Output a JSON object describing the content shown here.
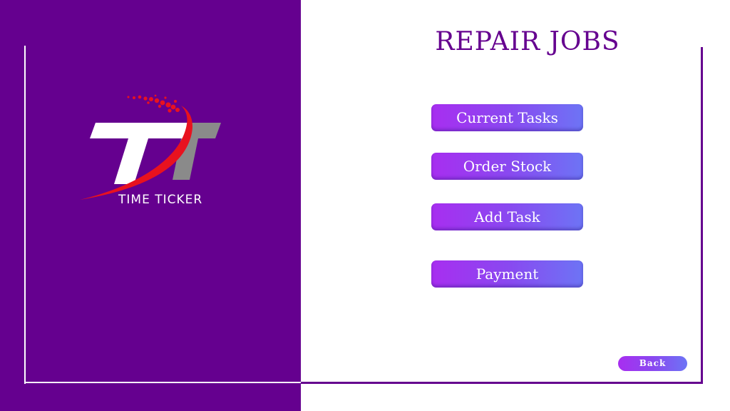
{
  "title": "REPAIR JOBS",
  "logo": {
    "text": "TIME TICKER",
    "colors": {
      "white": "#ffffff",
      "gray": "#8a8a8a",
      "red": "#e8121f"
    }
  },
  "menu": {
    "current_tasks": "Current Tasks",
    "order_stock": "Order Stock",
    "add_task": "Add Task",
    "payment": "Payment"
  },
  "back": "Back",
  "colors": {
    "panel": "#65008f",
    "button_start": "#a82ef0",
    "button_end": "#6d74f5",
    "background": "#ffffff"
  }
}
